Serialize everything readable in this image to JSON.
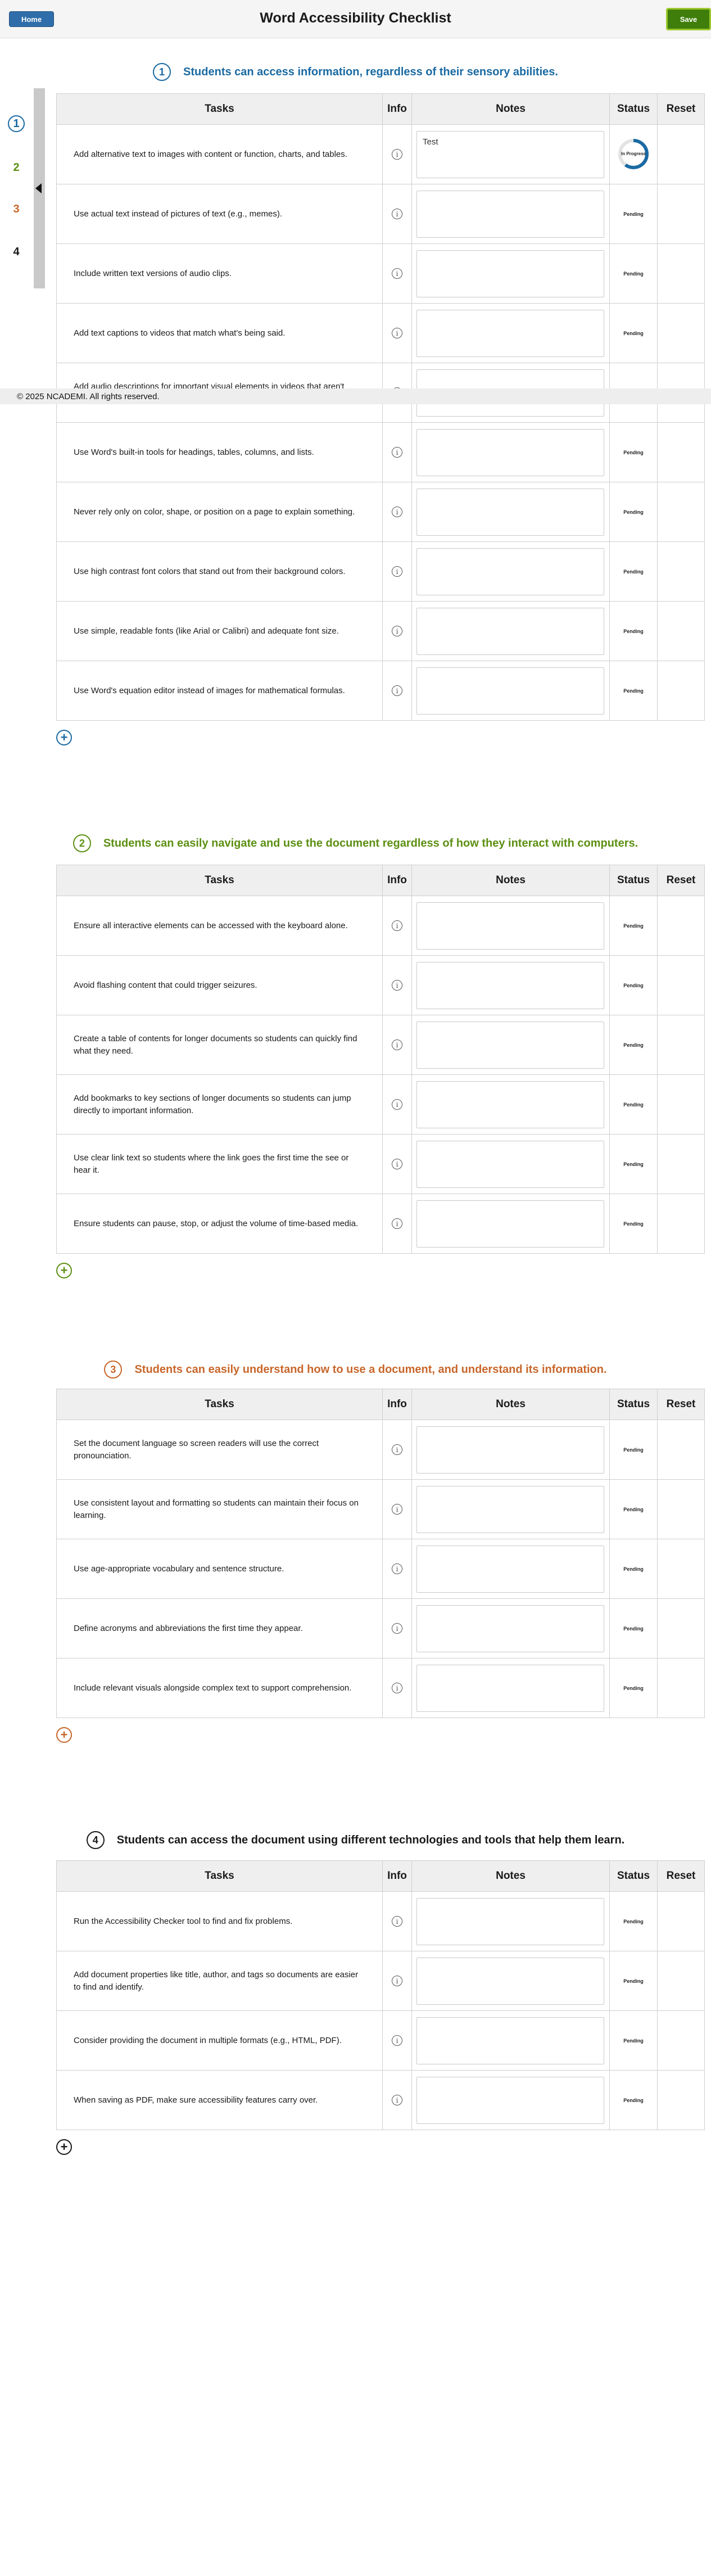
{
  "header": {
    "home_label": "Home",
    "title": "Word Accessibility Checklist",
    "save_label": "Save"
  },
  "sidenav": {
    "items": [
      "1",
      "2",
      "3",
      "4"
    ],
    "colors": [
      "#1a6aa3",
      "#5c8f12",
      "#c8662a",
      "#1a1a1a"
    ]
  },
  "footer": {
    "text": "© 2025 NCADEMI. All rights reserved."
  },
  "table_headers": {
    "tasks": "Tasks",
    "info": "Info",
    "notes": "Notes",
    "status": "Status",
    "reset": "Reset"
  },
  "info_icon": "info-circle-icon",
  "add_icon": "plus-circle-icon",
  "sections": [
    {
      "number": "1",
      "title": "Students can access information, regardless of their sensory abilities.",
      "color": "#1a6aa3",
      "tasks": [
        {
          "text": "Add alternative text to images with content or function, charts, and tables.",
          "note": "Test",
          "status": "In Progress",
          "progress": 0.6
        },
        {
          "text": "Use actual text instead of pictures of text (e.g., memes).",
          "note": "",
          "status": "Pending"
        },
        {
          "text": "Include written text versions of audio clips.",
          "note": "",
          "status": "Pending"
        },
        {
          "text": "Add text captions to videos that match what's being said.",
          "note": "",
          "status": "Pending"
        },
        {
          "text": "Add audio descriptions for important visual elements in videos that aren't explained in the narration.",
          "note": "",
          "status": "Pending"
        },
        {
          "text": "Use Word's built-in tools for headings, tables, columns, and lists.",
          "note": "",
          "status": "Pending"
        },
        {
          "text": "Never rely only on color, shape, or position on a page to explain something.",
          "note": "",
          "status": "Pending"
        },
        {
          "text": "Use high contrast font colors that stand out from their background colors.",
          "note": "",
          "status": "Pending"
        },
        {
          "text": "Use simple, readable fonts (like Arial or Calibri) and adequate font size.",
          "note": "",
          "status": "Pending"
        },
        {
          "text": "Use Word's equation editor instead of images for mathematical formulas.",
          "note": "",
          "status": "Pending"
        }
      ]
    },
    {
      "number": "2",
      "title": "Students can easily navigate and use the document regardless of how they interact with computers.",
      "color": "#5c8f12",
      "tasks": [
        {
          "text": "Ensure all interactive elements can be accessed with the keyboard alone.",
          "note": "",
          "status": "Pending"
        },
        {
          "text": "Avoid flashing content that could trigger seizures.",
          "note": "",
          "status": "Pending"
        },
        {
          "text": "Create a table of contents for longer documents so students can quickly find what they need.",
          "note": "",
          "status": "Pending"
        },
        {
          "text": "Add bookmarks to key sections of longer documents so students can jump directly to important information.",
          "note": "",
          "status": "Pending"
        },
        {
          "text": "Use clear link text so students where the link goes the first time the see or hear it.",
          "note": "",
          "status": "Pending"
        },
        {
          "text": "Ensure students can pause, stop, or adjust the volume of time-based media.",
          "note": "",
          "status": "Pending"
        }
      ]
    },
    {
      "number": "3",
      "title": "Students can easily understand how to use a document, and understand its information.",
      "color": "#c8662a",
      "tasks": [
        {
          "text": "Set the document language so screen readers will use the correct pronounciation.",
          "note": "",
          "status": "Pending"
        },
        {
          "text": "Use consistent layout and formatting so students can maintain their focus on learning.",
          "note": "",
          "status": "Pending"
        },
        {
          "text": "Use age-appropriate vocabulary and sentence structure.",
          "note": "",
          "status": "Pending"
        },
        {
          "text": "Define acronyms and abbreviations the first time they appear.",
          "note": "",
          "status": "Pending"
        },
        {
          "text": "Include relevant visuals alongside complex text to support comprehension.",
          "note": "",
          "status": "Pending"
        }
      ]
    },
    {
      "number": "4",
      "title": "Students can access the document using different technologies and tools that help them learn.",
      "color": "#1a1a1a",
      "tasks": [
        {
          "text": "Run the Accessibility Checker tool to find and fix problems.",
          "note": "",
          "status": "Pending"
        },
        {
          "text": "Add document properties like title, author, and tags so documents are easier to find and identify.",
          "note": "",
          "status": "Pending"
        },
        {
          "text": "Consider providing the document in multiple formats (e.g., HTML, PDF).",
          "note": "",
          "status": "Pending"
        },
        {
          "text": "When saving as PDF, make sure accessibility features carry over.",
          "note": "",
          "status": "Pending"
        }
      ]
    }
  ]
}
